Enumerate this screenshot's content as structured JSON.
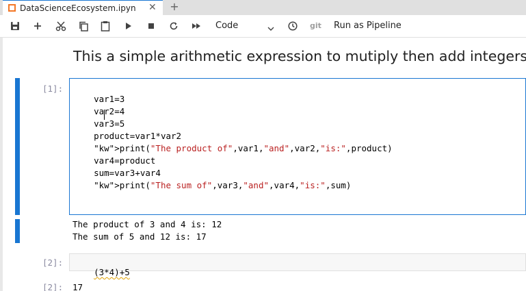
{
  "tab": {
    "title": "DataScienceEcosystem.ipyn",
    "close": "✕",
    "add": "+"
  },
  "toolbar": {
    "cell_type": "Code",
    "git_label": "git",
    "run_pipeline_label": "Run as Pipeline",
    "icons": [
      "save-icon",
      "add-icon",
      "cut-icon",
      "copy-icon",
      "paste-icon",
      "run-icon",
      "stop-icon",
      "restart-icon",
      "fast-forward-icon",
      "chevron-down-icon",
      "clock-icon"
    ]
  },
  "markdown": {
    "heading": "This a simple arithmetic expression to mutiply then add integers"
  },
  "cells": [
    {
      "prompt": "[1]:",
      "code_lines": [
        "var1=3",
        "var2=4",
        "var3=5",
        "product=var1*var2",
        "print(\"The product of\",var1,\"and\",var2,\"is:\",product)",
        "var4=product",
        "sum=var3+var4",
        "print(\"The sum of\",var3,\"and\",var4,\"is:\",sum)"
      ],
      "output_lines": [
        "The product of 3 and 4 is: 12",
        "The sum of 5 and 12 is: 17"
      ]
    },
    {
      "prompt": "[2]:",
      "code_lines": [
        "(3*4)+5"
      ],
      "output_prompt": "[2]:",
      "output_lines": [
        "17"
      ]
    }
  ],
  "colors": {
    "accent": "#1976d2",
    "keyword": "#008000",
    "string": "#ba2121",
    "logo": "#f37726"
  }
}
